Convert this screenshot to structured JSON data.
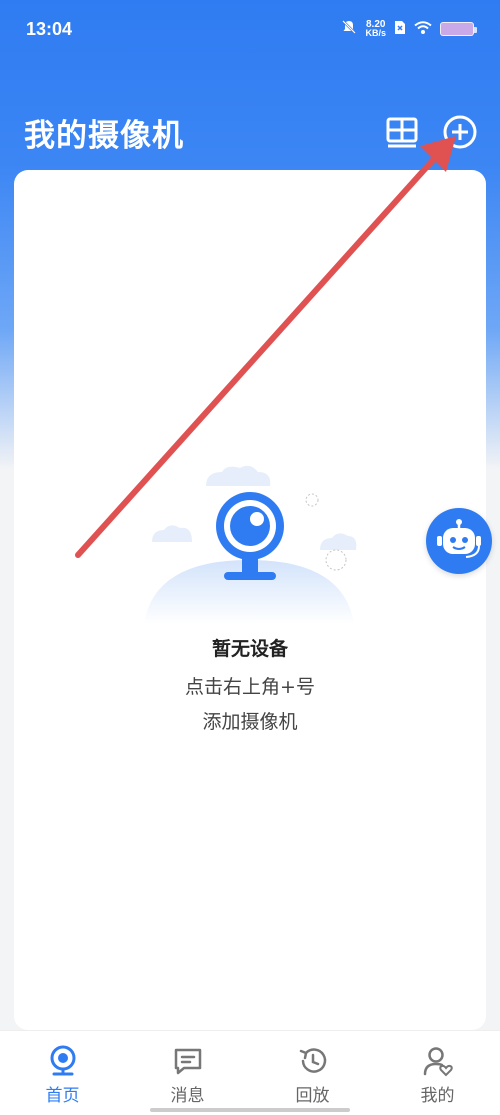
{
  "status_bar": {
    "time": "13:04",
    "net_speed_value": "8.20",
    "net_speed_unit": "KB/s"
  },
  "header": {
    "title": "我的摄像机",
    "icons": [
      "grid-layout-icon",
      "add-circle-icon"
    ]
  },
  "empty_state": {
    "title": "暂无设备",
    "line1": "点击右上角+号",
    "line2": "添加摄像机"
  },
  "tabs": [
    {
      "label": "首页",
      "icon": "camera-home-icon",
      "active": true
    },
    {
      "label": "消息",
      "icon": "message-icon",
      "active": false
    },
    {
      "label": "回放",
      "icon": "history-icon",
      "active": false
    },
    {
      "label": "我的",
      "icon": "profile-icon",
      "active": false
    }
  ],
  "colors": {
    "primary": "#2f7cf2",
    "arrow": "#e05252"
  }
}
